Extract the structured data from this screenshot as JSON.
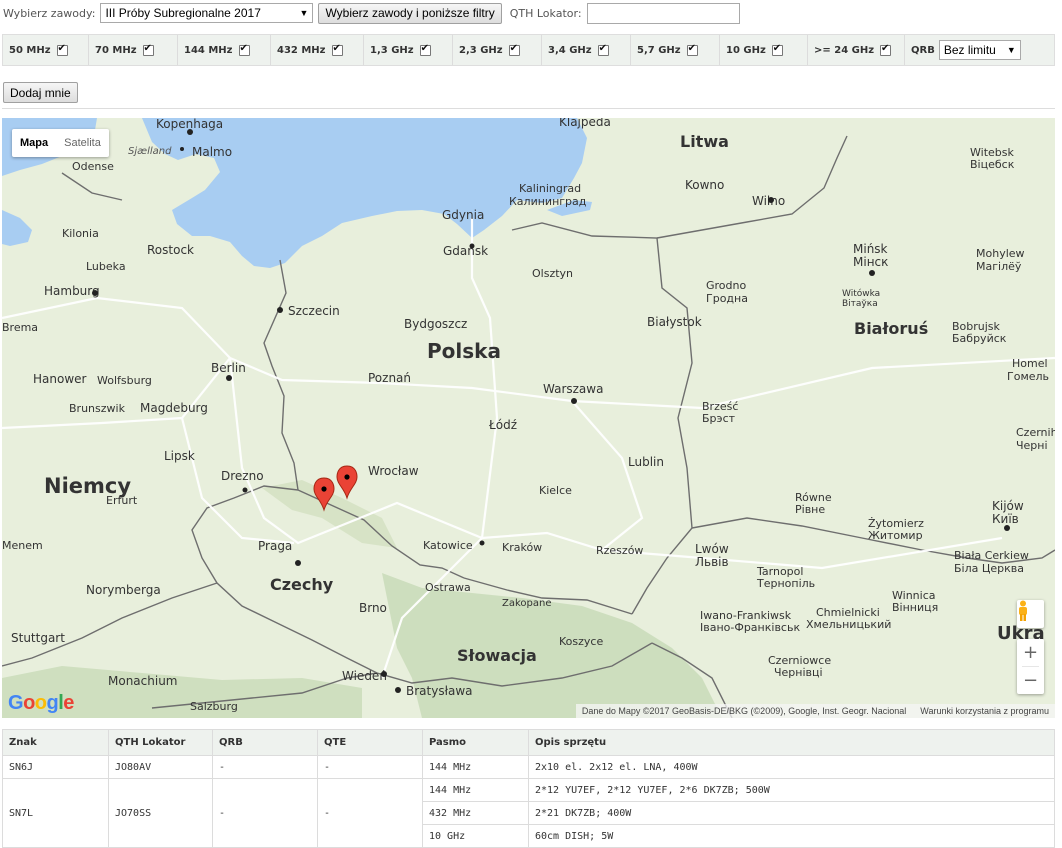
{
  "filters": {
    "contest_label": "Wybierz zawody:",
    "contest_selected": "III Próby Subregionalne 2017",
    "apply_button": "Wybierz zawody i poniższe filtry",
    "qth_label": "QTH Lokator:",
    "qth_value": "",
    "bands": [
      "50 MHz",
      "70 MHz",
      "144 MHz",
      "432 MHz",
      "1,3 GHz",
      "2,3 GHz",
      "3,4 GHz",
      "5,7 GHz",
      "10 GHz",
      ">= 24 GHz"
    ],
    "qrb_label": "QRB",
    "qrb_selected": "Bez limitu"
  },
  "add_button": "Dodaj mnie",
  "map": {
    "type_controls": [
      "Mapa",
      "Satelita"
    ],
    "active_type": "Mapa",
    "attribution": "Dane do Mapy ©2017 GeoBasis-DE/BKG (©2009), Google, Inst. Geogr. Nacional",
    "terms": "Warunki korzystania z programu",
    "logo": "Google",
    "countries": [
      "Litwa",
      "Białoruś",
      "Polska",
      "Niemcy",
      "Czechy",
      "Słowacja",
      "Ukra"
    ],
    "cities": {
      "klajpeda": "Klajpeda",
      "kopenhaga": "Kopenhaga",
      "malmo": "Malmo",
      "sjaelland": "Sjælland",
      "odense": "Odense",
      "kilonia": "Kilonia",
      "rostock": "Rostock",
      "lubeka": "Lubeka",
      "hamburg": "Hamburg",
      "brema": "Brema",
      "szczecin": "Szczecin",
      "berlin": "Berlin",
      "hanower": "Hanower",
      "wolfsburg": "Wolfsburg",
      "brunszwik": "Brunszwik",
      "magdeburg": "Magdeburg",
      "lipsk": "Lipsk",
      "drezno": "Drezno",
      "erfurt": "Erfurt",
      "menem": "Menem",
      "praga": "Praga",
      "norymberga": "Norymberga",
      "stuttgart": "Stuttgart",
      "monachium": "Monachium",
      "salzburg": "Salzburg",
      "wieden": "Wiedeń",
      "bratyslawa": "Bratysława",
      "brno": "Brno",
      "ostrawa": "Ostrawa",
      "zakopane": "Zakopane",
      "koszyce": "Koszyce",
      "katowice": "Katowice",
      "krakow": "Kraków",
      "rzeszow": "Rzeszów",
      "kielce": "Kielce",
      "lublin": "Lublin",
      "lodz": "Łódź",
      "warszawa": "Warszawa",
      "wroclaw": "Wrocław",
      "poznan": "Poznań",
      "bydgoszcz": "Bydgoszcz",
      "gdynia": "Gdynia",
      "gdansk": "Gdańsk",
      "olsztyn": "Olsztyn",
      "bialystok": "Białystok",
      "kaliningrad": "Kaliningrad",
      "kaliningrad_ru": "Калининград",
      "kowno": "Kowno",
      "wilno": "Wilno",
      "grodno": "Grodno",
      "grodno_by": "Гродна",
      "witebsk": "Witebsk",
      "witebsk_by": "Віцебск",
      "minsk": "Mińsk",
      "minsk_by": "Мінск",
      "witowka": "Witówka",
      "witowka_by": "Вітаўка",
      "mohylew": "Mohylew",
      "mohylew_by": "Магілёў",
      "bobrujsk": "Bobrujsk",
      "bobrujsk_by": "Бабруйск",
      "homel": "Homel",
      "homel_by": "Гомель",
      "brzesc": "Brześć",
      "brzesc_by": "Брэст",
      "rowne": "Równe",
      "rowne_ua": "Рівне",
      "zytomierz": "Żytomierz",
      "zytomierz_ua": "Житомир",
      "kijow": "Kijów",
      "kijow_ua": "Київ",
      "czernihow": "Czernih",
      "czernihow_ua": "Черні",
      "lwow": "Lwów",
      "lwow_ua": "Львів",
      "tarnopol": "Tarnopol",
      "tarnopol_ua": "Тернопіль",
      "biala_cerkiew": "Biała Cerkiew",
      "biala_cerkiew_ua": "Біла Церква",
      "winnica": "Winnica",
      "winnica_ua": "Вінниця",
      "iwano": "Iwano-Frankiwsk",
      "iwano_ua": "Івано-Франківськ",
      "chmielnicki": "Chmielnicki",
      "chmielnicki_ua": "Хмельницький",
      "czerniowce": "Czerniowce",
      "czerniowce_ua": "Чернівці"
    }
  },
  "table": {
    "headers": [
      "Znak",
      "QTH Lokator",
      "QRB",
      "QTE",
      "Pasmo",
      "Opis sprzętu"
    ],
    "rows": [
      {
        "znak": "SN6J",
        "qth": "JO80AV",
        "qrb": "-",
        "qte": "-",
        "bands": [
          {
            "pasmo": "144 MHz",
            "opis": "2x10 el. 2x12 el. LNA, 400W"
          }
        ]
      },
      {
        "znak": "SN7L",
        "qth": "JO70SS",
        "qrb": "-",
        "qte": "-",
        "bands": [
          {
            "pasmo": "144 MHz",
            "opis": "2*12 YU7EF, 2*12 YU7EF, 2*6 DK7ZB; 500W"
          },
          {
            "pasmo": "432 MHz",
            "opis": "2*21 DK7ZB; 400W"
          },
          {
            "pasmo": "10 GHz",
            "opis": "60cm DISH; 5W"
          }
        ]
      }
    ]
  },
  "colors": {
    "water": "#a8cdf2",
    "land": "#e8efdc",
    "border": "#6e6e6e",
    "marker": "#ea4335",
    "filter_bg": "#eef2ee"
  }
}
